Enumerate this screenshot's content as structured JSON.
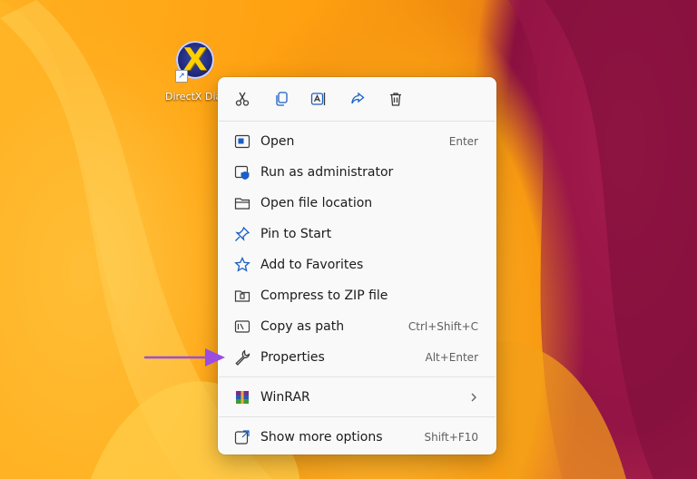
{
  "desktop": {
    "icon_label": "DirectX Diagnost"
  },
  "toolbar": {
    "buttons": [
      "cut-icon",
      "copy-icon",
      "rename-icon",
      "share-icon",
      "delete-icon"
    ]
  },
  "menu": {
    "items": [
      {
        "label": "Open",
        "accel": "Enter",
        "icon": "open-icon"
      },
      {
        "label": "Run as administrator",
        "accel": "",
        "icon": "shield-icon"
      },
      {
        "label": "Open file location",
        "accel": "",
        "icon": "folder-icon"
      },
      {
        "label": "Pin to Start",
        "accel": "",
        "icon": "pin-icon"
      },
      {
        "label": "Add to Favorites",
        "accel": "",
        "icon": "star-icon"
      },
      {
        "label": "Compress to ZIP file",
        "accel": "",
        "icon": "zip-icon"
      },
      {
        "label": "Copy as path",
        "accel": "Ctrl+Shift+C",
        "icon": "path-icon"
      },
      {
        "label": "Properties",
        "accel": "Alt+Enter",
        "icon": "wrench-icon"
      },
      {
        "label": "WinRAR",
        "accel": "",
        "icon": "winrar-icon"
      },
      {
        "label": "Show more options",
        "accel": "Shift+F10",
        "icon": "more-options-icon"
      }
    ]
  },
  "colors": {
    "menu_bg": "#f9f9f9",
    "accent": "#1a5fc8",
    "annotation_arrow": "#9b4de0"
  }
}
